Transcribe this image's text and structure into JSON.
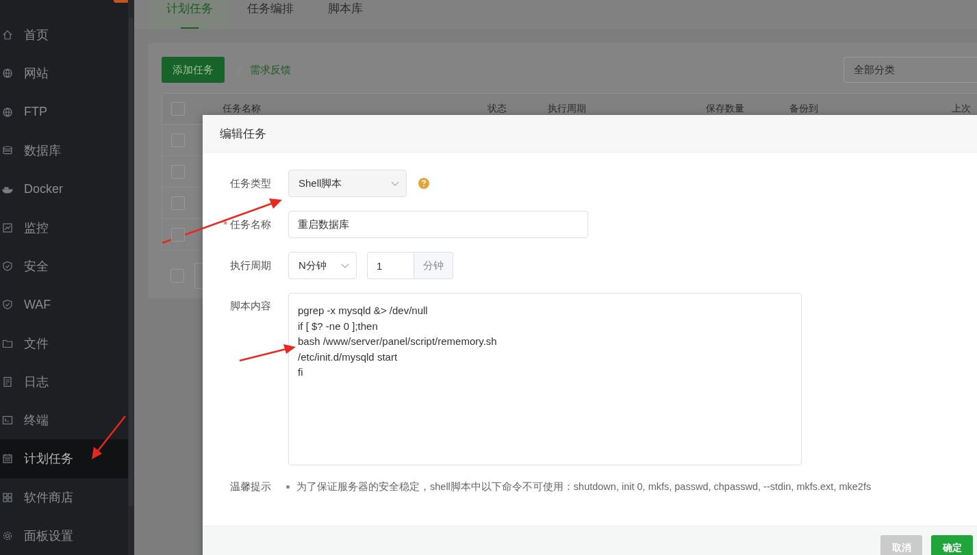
{
  "sidebar": {
    "items": [
      {
        "label": "首页",
        "selected": false
      },
      {
        "label": "网站",
        "selected": false
      },
      {
        "label": "FTP",
        "selected": false
      },
      {
        "label": "数据库",
        "selected": false
      },
      {
        "label": "Docker",
        "selected": false
      },
      {
        "label": "监控",
        "selected": false
      },
      {
        "label": "安全",
        "selected": false
      },
      {
        "label": "WAF",
        "selected": false
      },
      {
        "label": "文件",
        "selected": false
      },
      {
        "label": "日志",
        "selected": false
      },
      {
        "label": "终端",
        "selected": false
      },
      {
        "label": "计划任务",
        "selected": true
      },
      {
        "label": "软件商店",
        "selected": false
      },
      {
        "label": "面板设置",
        "selected": false
      }
    ]
  },
  "tabs": [
    {
      "label": "计划任务",
      "selected": true
    },
    {
      "label": "任务编排",
      "selected": false
    },
    {
      "label": "脚本库",
      "selected": false
    }
  ],
  "toolbar": {
    "add_button": "添加任务",
    "feedback_link": "需求反馈",
    "category_select": "全部分类"
  },
  "table": {
    "header_checked": false,
    "footer_checked": false,
    "columns": [
      "任务名称",
      "状态",
      "执行周期",
      "保存数量",
      "备份到",
      "上次"
    ],
    "rows": [
      {
        "checked": false
      },
      {
        "checked": false
      },
      {
        "checked": false
      },
      {
        "checked": false
      }
    ]
  },
  "dialog": {
    "title": "编辑任务",
    "task_type": {
      "label": "任务类型",
      "value": "Shell脚本"
    },
    "task_name": {
      "label": "任务名称",
      "required_mark": "*",
      "value": "重启数据库"
    },
    "period": {
      "label": "执行周期",
      "unit": "N分钟",
      "value": "1",
      "addon": "分钟"
    },
    "script": {
      "label": "脚本内容",
      "lines": [
        "pgrep -x mysqld &> /dev/null",
        "if [ $? -ne 0 ];then",
        "bash /www/server/panel/script/rememory.sh",
        "/etc/init.d/mysqld start",
        "fi"
      ]
    },
    "tip": {
      "label": "温馨提示",
      "text": "为了保证服务器的安全稳定，shell脚本中以下命令不可使用：shutdown, init 0, mkfs, passwd, chpasswd, --stdin, mkfs.ext, mke2fs"
    },
    "buttons": {
      "cancel": "取消",
      "confirm": "确定"
    }
  }
}
